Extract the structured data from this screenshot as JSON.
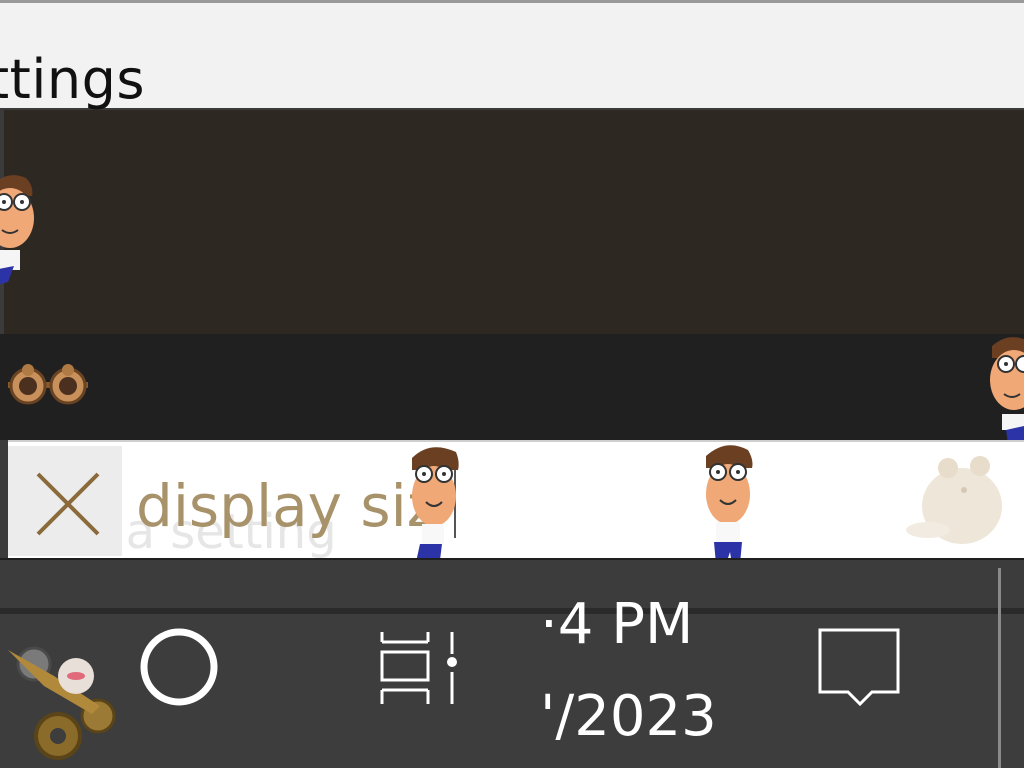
{
  "window": {
    "title": "ttings"
  },
  "search": {
    "value": "display siz",
    "placeholder": "Find a setting"
  },
  "taskbar": {
    "time": "·4 PM",
    "date": "'/2023"
  },
  "icons": {
    "clear": "close-icon",
    "cortana": "cortana-circle-icon",
    "task_view": "task-view-icon",
    "notifications": "action-center-icon",
    "start": "start-gear-icon",
    "goggles": "steampunk-goggles-icon",
    "mascot": "cartoon-character-sprite",
    "hamster": "hamster-watermark-icon"
  },
  "colors": {
    "titlebar": "#f2f2f2",
    "banner": "#2e2823",
    "strip": "#202020",
    "taskbar": "#3d3d3d",
    "search_text": "#a8926a"
  }
}
